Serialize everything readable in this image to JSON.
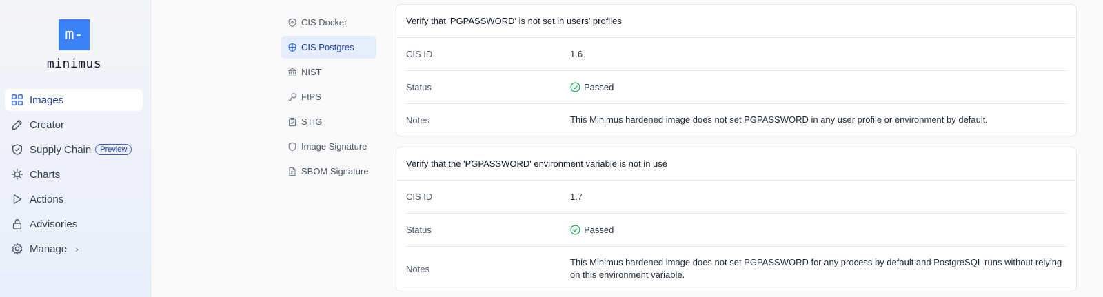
{
  "brand": {
    "logo_glyph": "m-",
    "name": "minimus",
    "accent": "#3b82f6"
  },
  "sidebar": {
    "items": [
      {
        "label": "Images",
        "icon": "grid-icon",
        "active": true
      },
      {
        "label": "Creator",
        "icon": "pencil-icon"
      },
      {
        "label": "Supply Chain",
        "icon": "shield-link-icon",
        "badge": "Preview"
      },
      {
        "label": "Charts",
        "icon": "helm-icon"
      },
      {
        "label": "Actions",
        "icon": "play-icon"
      },
      {
        "label": "Advisories",
        "icon": "lock-icon"
      },
      {
        "label": "Manage",
        "icon": "gear-icon",
        "chevron": "›"
      }
    ]
  },
  "compliance_nav": {
    "items": [
      {
        "label": "CIS Docker",
        "icon": "shield-icon"
      },
      {
        "label": "CIS Postgres",
        "icon": "shield-icon",
        "active": true
      },
      {
        "label": "NIST",
        "icon": "building-icon"
      },
      {
        "label": "FIPS",
        "icon": "key-icon"
      },
      {
        "label": "STIG",
        "icon": "clipboard-icon"
      },
      {
        "label": "Image Signature",
        "icon": "shield-outline-icon"
      },
      {
        "label": "SBOM Signature",
        "icon": "document-icon"
      }
    ]
  },
  "checks": [
    {
      "title": "Verify that 'PGPASSWORD' is not set in users' profiles",
      "cis_id_label": "CIS ID",
      "cis_id": "1.6",
      "status_label": "Status",
      "status": "Passed",
      "notes_label": "Notes",
      "notes": "This Minimus hardened image does not set PGPASSWORD in any user profile or environment by default."
    },
    {
      "title": "Verify that the 'PGPASSWORD' environment variable is not in use",
      "cis_id_label": "CIS ID",
      "cis_id": "1.7",
      "status_label": "Status",
      "status": "Passed",
      "notes_label": "Notes",
      "notes": "This Minimus hardened image does not set PGPASSWORD for any process by default and PostgreSQL runs without relying on this environment variable."
    }
  ],
  "colors": {
    "passed": "#166534",
    "active_bg": "#e5edfb"
  }
}
